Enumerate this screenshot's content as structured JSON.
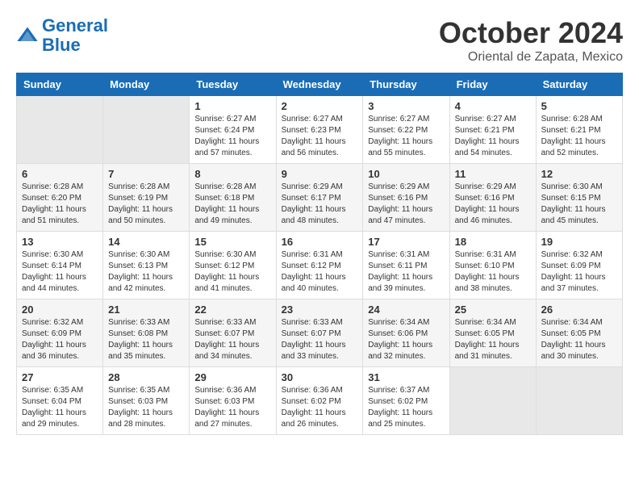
{
  "logo": {
    "line1": "General",
    "line2": "Blue"
  },
  "title": "October 2024",
  "location": "Oriental de Zapata, Mexico",
  "weekdays": [
    "Sunday",
    "Monday",
    "Tuesday",
    "Wednesday",
    "Thursday",
    "Friday",
    "Saturday"
  ],
  "weeks": [
    [
      {
        "day": "",
        "info": ""
      },
      {
        "day": "",
        "info": ""
      },
      {
        "day": "1",
        "info": "Sunrise: 6:27 AM\nSunset: 6:24 PM\nDaylight: 11 hours and 57 minutes."
      },
      {
        "day": "2",
        "info": "Sunrise: 6:27 AM\nSunset: 6:23 PM\nDaylight: 11 hours and 56 minutes."
      },
      {
        "day": "3",
        "info": "Sunrise: 6:27 AM\nSunset: 6:22 PM\nDaylight: 11 hours and 55 minutes."
      },
      {
        "day": "4",
        "info": "Sunrise: 6:27 AM\nSunset: 6:21 PM\nDaylight: 11 hours and 54 minutes."
      },
      {
        "day": "5",
        "info": "Sunrise: 6:28 AM\nSunset: 6:21 PM\nDaylight: 11 hours and 52 minutes."
      }
    ],
    [
      {
        "day": "6",
        "info": "Sunrise: 6:28 AM\nSunset: 6:20 PM\nDaylight: 11 hours and 51 minutes."
      },
      {
        "day": "7",
        "info": "Sunrise: 6:28 AM\nSunset: 6:19 PM\nDaylight: 11 hours and 50 minutes."
      },
      {
        "day": "8",
        "info": "Sunrise: 6:28 AM\nSunset: 6:18 PM\nDaylight: 11 hours and 49 minutes."
      },
      {
        "day": "9",
        "info": "Sunrise: 6:29 AM\nSunset: 6:17 PM\nDaylight: 11 hours and 48 minutes."
      },
      {
        "day": "10",
        "info": "Sunrise: 6:29 AM\nSunset: 6:16 PM\nDaylight: 11 hours and 47 minutes."
      },
      {
        "day": "11",
        "info": "Sunrise: 6:29 AM\nSunset: 6:16 PM\nDaylight: 11 hours and 46 minutes."
      },
      {
        "day": "12",
        "info": "Sunrise: 6:30 AM\nSunset: 6:15 PM\nDaylight: 11 hours and 45 minutes."
      }
    ],
    [
      {
        "day": "13",
        "info": "Sunrise: 6:30 AM\nSunset: 6:14 PM\nDaylight: 11 hours and 44 minutes."
      },
      {
        "day": "14",
        "info": "Sunrise: 6:30 AM\nSunset: 6:13 PM\nDaylight: 11 hours and 42 minutes."
      },
      {
        "day": "15",
        "info": "Sunrise: 6:30 AM\nSunset: 6:12 PM\nDaylight: 11 hours and 41 minutes."
      },
      {
        "day": "16",
        "info": "Sunrise: 6:31 AM\nSunset: 6:12 PM\nDaylight: 11 hours and 40 minutes."
      },
      {
        "day": "17",
        "info": "Sunrise: 6:31 AM\nSunset: 6:11 PM\nDaylight: 11 hours and 39 minutes."
      },
      {
        "day": "18",
        "info": "Sunrise: 6:31 AM\nSunset: 6:10 PM\nDaylight: 11 hours and 38 minutes."
      },
      {
        "day": "19",
        "info": "Sunrise: 6:32 AM\nSunset: 6:09 PM\nDaylight: 11 hours and 37 minutes."
      }
    ],
    [
      {
        "day": "20",
        "info": "Sunrise: 6:32 AM\nSunset: 6:09 PM\nDaylight: 11 hours and 36 minutes."
      },
      {
        "day": "21",
        "info": "Sunrise: 6:33 AM\nSunset: 6:08 PM\nDaylight: 11 hours and 35 minutes."
      },
      {
        "day": "22",
        "info": "Sunrise: 6:33 AM\nSunset: 6:07 PM\nDaylight: 11 hours and 34 minutes."
      },
      {
        "day": "23",
        "info": "Sunrise: 6:33 AM\nSunset: 6:07 PM\nDaylight: 11 hours and 33 minutes."
      },
      {
        "day": "24",
        "info": "Sunrise: 6:34 AM\nSunset: 6:06 PM\nDaylight: 11 hours and 32 minutes."
      },
      {
        "day": "25",
        "info": "Sunrise: 6:34 AM\nSunset: 6:05 PM\nDaylight: 11 hours and 31 minutes."
      },
      {
        "day": "26",
        "info": "Sunrise: 6:34 AM\nSunset: 6:05 PM\nDaylight: 11 hours and 30 minutes."
      }
    ],
    [
      {
        "day": "27",
        "info": "Sunrise: 6:35 AM\nSunset: 6:04 PM\nDaylight: 11 hours and 29 minutes."
      },
      {
        "day": "28",
        "info": "Sunrise: 6:35 AM\nSunset: 6:03 PM\nDaylight: 11 hours and 28 minutes."
      },
      {
        "day": "29",
        "info": "Sunrise: 6:36 AM\nSunset: 6:03 PM\nDaylight: 11 hours and 27 minutes."
      },
      {
        "day": "30",
        "info": "Sunrise: 6:36 AM\nSunset: 6:02 PM\nDaylight: 11 hours and 26 minutes."
      },
      {
        "day": "31",
        "info": "Sunrise: 6:37 AM\nSunset: 6:02 PM\nDaylight: 11 hours and 25 minutes."
      },
      {
        "day": "",
        "info": ""
      },
      {
        "day": "",
        "info": ""
      }
    ]
  ]
}
